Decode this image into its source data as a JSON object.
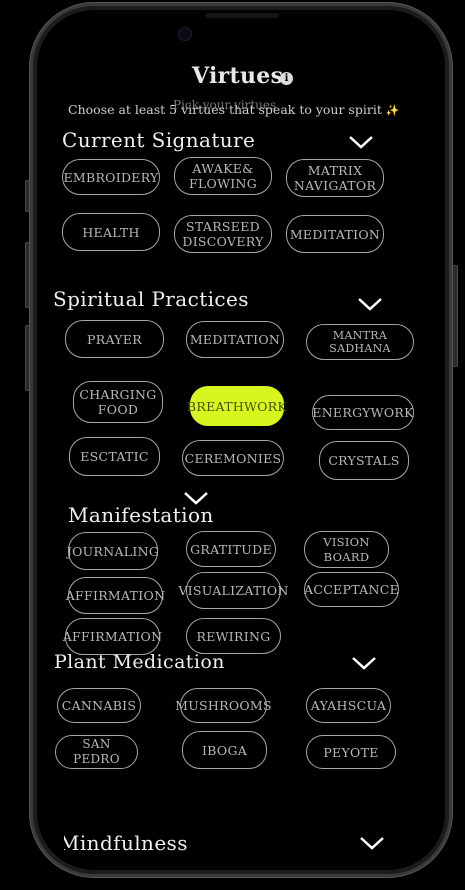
{
  "header": {
    "title": "Virtues",
    "info_icon": "i",
    "subtitle": "Choose at least 5 virtues that speak to your spirit",
    "subtitle_icon": "✨",
    "ghost_text": "Pick your virtues"
  },
  "colors": {
    "accent": "#d8f51f",
    "pill_border": "#a7a7a7",
    "background": "#000000"
  },
  "sections": {
    "current_signature": {
      "title": "Current Signature",
      "chips": [
        "EMBROIDERY",
        "AWAKE&\nFLOWING",
        "MATRIX\nNAVIGATOR",
        "HEALTH",
        "STARSEED\nDISCOVERY",
        "MEDITATION"
      ]
    },
    "spiritual_practices": {
      "title": "Spiritual Practices",
      "chips": [
        "PRAYER",
        "MEDITATION",
        "MANTRA\nSADHANA",
        "CHARGING\nFOOD",
        "BREATHWORK",
        "ENERGYWORK",
        "ESCTATIC",
        "CEREMONIES",
        "CRYSTALS"
      ],
      "selected": "BREATHWORK"
    },
    "manifestation": {
      "title": "Manifestation",
      "chips": [
        "JOURNALING",
        "GRATITUDE",
        "VISION BOARD",
        "AFFIRMATION",
        "VISUALIZATION",
        "ACCEPTANCE",
        "AFFIRMATION",
        "REWIRING"
      ]
    },
    "plant_medication": {
      "title": "Plant Medication",
      "chips": [
        "CANNABIS",
        "MUSHROOMS",
        "AYAHSCUA",
        "SAN PEDRO",
        "IBOGA",
        "PEYOTE"
      ]
    },
    "mindfulness": {
      "title": "Mindfulness"
    }
  }
}
